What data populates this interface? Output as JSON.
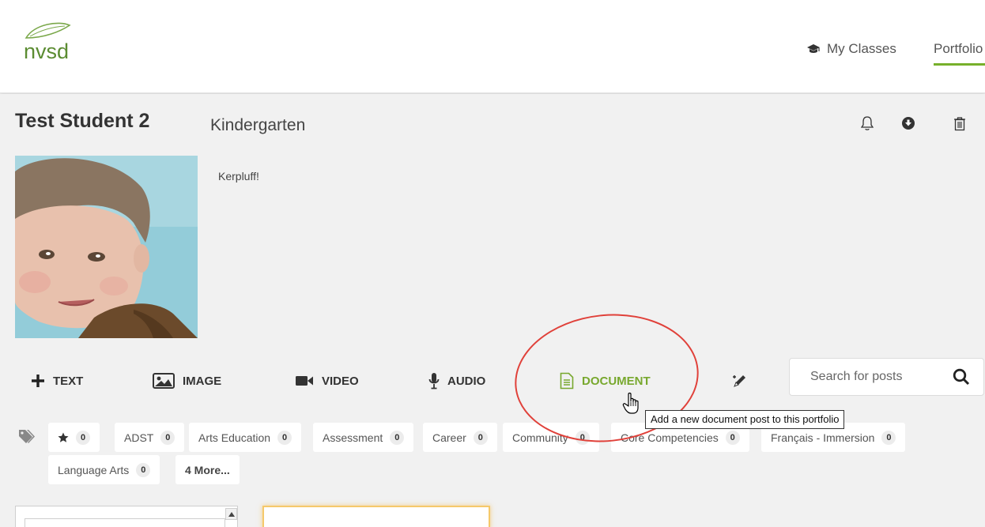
{
  "header": {
    "logo_text": "nvsd",
    "nav": {
      "my_classes": "My Classes",
      "portfolio": "Portfolio"
    },
    "icons": {
      "my_classes": "graduation-cap-icon"
    }
  },
  "student": {
    "name": "Test Student 2",
    "grade": "Kindergarten",
    "bio": "Kerpluff!"
  },
  "top_actions": {
    "icons": [
      "bell-icon",
      "download-icon",
      "trash-icon"
    ]
  },
  "post_toolbar": {
    "buttons": [
      {
        "label": "TEXT",
        "icon": "plus-icon"
      },
      {
        "label": "IMAGE",
        "icon": "image-icon"
      },
      {
        "label": "VIDEO",
        "icon": "video-camera-icon"
      },
      {
        "label": "AUDIO",
        "icon": "microphone-icon"
      },
      {
        "label": "DOCUMENT",
        "icon": "document-icon"
      },
      {
        "icon": "pencil-icon"
      }
    ],
    "active": "DOCUMENT",
    "tooltip": "Add a new document post to this portfolio"
  },
  "search": {
    "placeholder": "Search for posts",
    "value": ""
  },
  "tags": {
    "items": [
      {
        "label": "",
        "icon": "star-icon",
        "count": "0"
      },
      {
        "label": "ADST",
        "count": "0"
      },
      {
        "label": "Arts Education",
        "count": "0"
      },
      {
        "label": "Assessment",
        "count": "0"
      },
      {
        "label": "Career",
        "count": "0"
      },
      {
        "label": "Community",
        "count": "0"
      },
      {
        "label": "Core Competencies",
        "count": "0"
      },
      {
        "label": "Français - Immersion",
        "count": "0"
      },
      {
        "label": "Language Arts",
        "count": "0"
      }
    ],
    "more_label": "4 More..."
  },
  "colors": {
    "accent_green": "#77b02b",
    "highlight_red": "#e0413a",
    "panel_glow": "#f5c96b"
  }
}
